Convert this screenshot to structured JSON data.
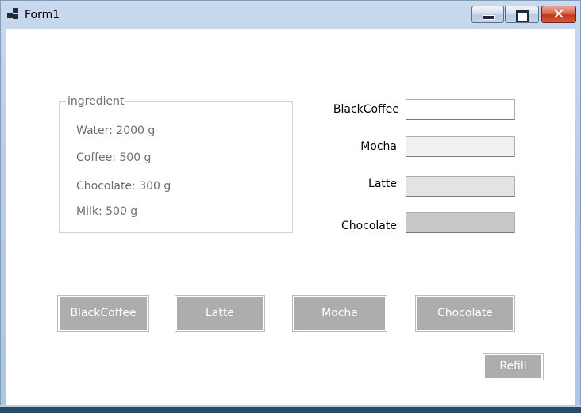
{
  "window": {
    "title": "Form1"
  },
  "ingredient": {
    "title": "ingredient",
    "items": [
      "Water: 2000 g",
      "Coffee: 500 g",
      "Chocolate: 300 g",
      "Milk: 500 g"
    ]
  },
  "fields": [
    {
      "label": "BlackCoffee",
      "value": "",
      "bg": "#ffffff"
    },
    {
      "label": "Mocha",
      "value": "",
      "bg": "#f0f0f0"
    },
    {
      "label": "Latte",
      "value": "",
      "bg": "#e3e3e3"
    },
    {
      "label": "Chocolate",
      "value": "",
      "bg": "#c8c8c8"
    }
  ],
  "buttons": [
    "BlackCoffee",
    "Latte",
    "Mocha",
    "Chocolate"
  ],
  "refill_label": "Refill",
  "colors": {
    "button_bg": "#adadad",
    "button_text": "#ffffff"
  }
}
